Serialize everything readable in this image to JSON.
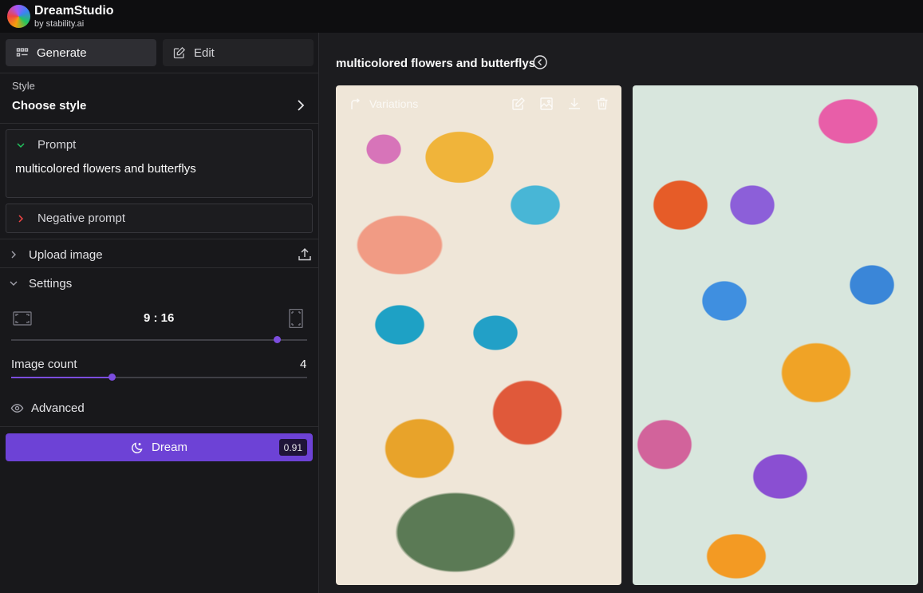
{
  "brand": {
    "name": "DreamStudio",
    "sub": "by stability.ai"
  },
  "tabs": [
    {
      "label": "Generate"
    },
    {
      "label": "Edit"
    }
  ],
  "style": {
    "label": "Style",
    "value": "Choose style"
  },
  "prompt": {
    "label": "Prompt",
    "text": "multicolored flowers and butterflys"
  },
  "negative_prompt": {
    "label": "Negative prompt"
  },
  "upload": {
    "label": "Upload image"
  },
  "settings": {
    "label": "Settings",
    "aspect_ratio": "9 : 16",
    "aspect_ratio_slider_fraction": 0.9,
    "image_count_label": "Image count",
    "image_count": "4",
    "image_count_slider_fraction": 0.34
  },
  "advanced": {
    "label": "Advanced"
  },
  "dream": {
    "label": "Dream",
    "cost": "0.91"
  },
  "main": {
    "title": "multicolored flowers and butterflys"
  },
  "card": {
    "variations_label": "Variations"
  },
  "colors": {
    "accent": "#6d42d6",
    "background": "#18181b"
  }
}
